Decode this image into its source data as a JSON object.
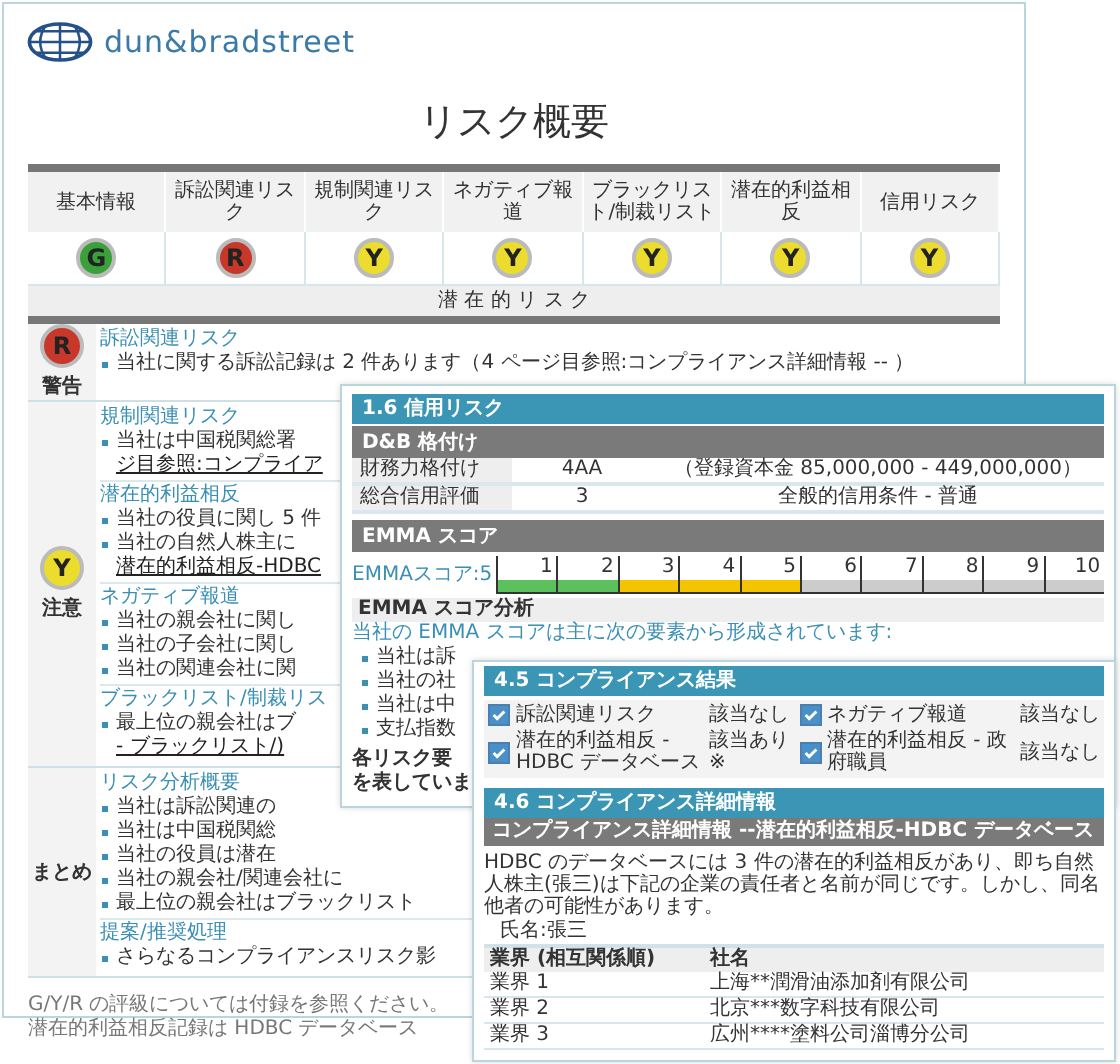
{
  "report": {
    "brand": "dun&bradstreet",
    "title": "リスク概要",
    "summary": [
      {
        "label": "基本情報",
        "rating": "G",
        "color": "#3aa13a"
      },
      {
        "label": "訴訟関連リスク",
        "rating": "R",
        "color": "#c8382a"
      },
      {
        "label": "規制関連リスク",
        "rating": "Y",
        "color": "#ecdc2e"
      },
      {
        "label": "ネガティブ報道",
        "rating": "Y",
        "color": "#ecdc2e"
      },
      {
        "label": "ブラックリスト/制裁リスト",
        "rating": "Y",
        "color": "#ecdc2e"
      },
      {
        "label": "潜在的利益相反",
        "rating": "Y",
        "color": "#ecdc2e"
      },
      {
        "label": "信用リスク",
        "rating": "Y",
        "color": "#ecdc2e"
      }
    ],
    "band": "潜 在 的 リ ス ク",
    "rows": [
      {
        "rating": "R",
        "color": "#c8382a",
        "label": "警告",
        "sections": [
          {
            "heading": "訴訟関連リスク",
            "lines": [
              {
                "kind": "bullet",
                "text": "当社に関する訴訟記録は 2 件あります（4 ページ目参照:コンプライアンス詳細情報 -- ）"
              }
            ]
          }
        ]
      },
      {
        "rating": "Y",
        "color": "#ecdc2e",
        "label": "注意",
        "sections": [
          {
            "heading": "規制関連リスク",
            "lines": [
              {
                "kind": "bullet",
                "text": "当社は中国税関総署"
              },
              {
                "kind": "link",
                "text": "ジ目参照:コンプライア"
              }
            ]
          },
          {
            "heading": "潜在的利益相反",
            "lines": [
              {
                "kind": "bullet",
                "text": "当社の役員に関し 5 件"
              },
              {
                "kind": "bullet",
                "text": "当社の自然人株主に"
              },
              {
                "kind": "link",
                "text": "潜在的利益相反-HDBC"
              }
            ]
          },
          {
            "heading": "ネガティブ報道",
            "lines": [
              {
                "kind": "bullet",
                "text": "当社の親会社に関し"
              },
              {
                "kind": "bullet",
                "text": "当社の子会社に関し"
              },
              {
                "kind": "bullet",
                "text": "当社の関連会社に関"
              }
            ]
          },
          {
            "heading": "ブラックリスト/制裁リス",
            "lines": [
              {
                "kind": "bullet",
                "text": "最上位の親会社はブ"
              },
              {
                "kind": "link",
                "text": "- ブラックリスト/)"
              }
            ]
          }
        ]
      },
      {
        "label": "まとめ",
        "sections": [
          {
            "heading": "リスク分析概要",
            "lines": [
              {
                "kind": "bullet",
                "text": "当社は訴訟関連の"
              },
              {
                "kind": "bullet",
                "text": "当社は中国税関総"
              },
              {
                "kind": "bullet",
                "text": "当社の役員は潜在"
              },
              {
                "kind": "bullet",
                "text": "当社の親会社/関連会社に"
              },
              {
                "kind": "bullet",
                "text": "最上位の親会社はブラックリスト"
              }
            ]
          },
          {
            "heading": "提案/推奨処理",
            "lines": [
              {
                "kind": "bullet",
                "text": "さらなるコンプライアンスリスク影"
              }
            ]
          }
        ]
      }
    ],
    "footnotes": [
      "G/Y/R の評級については付録を参照ください。",
      "潜在的利益相反記録は HDBC データベース"
    ]
  },
  "credit": {
    "title": "1.6 信用リスク",
    "subtitle": "D&B 格付け",
    "ratings": [
      {
        "name": "財務力格付け",
        "value": "4AA",
        "note": "（登録資本金 85,000,000 - 449,000,000）"
      },
      {
        "name": "総合信用評価",
        "value": "3",
        "note": "全般的信用条件 - 普通"
      }
    ],
    "emma_title": "EMMA スコア",
    "emma_label": "EMMAスコア:5",
    "scale": [
      {
        "label": "1",
        "color": "#5cc05c"
      },
      {
        "label": "2",
        "color": "#5cc05c"
      },
      {
        "label": "3",
        "color": "#f5c400"
      },
      {
        "label": "4",
        "color": "#f5c400"
      },
      {
        "label": "5",
        "color": "#f5c400"
      },
      {
        "label": "6",
        "color": "#cccccc"
      },
      {
        "label": "7",
        "color": "#cccccc"
      },
      {
        "label": "8",
        "color": "#cccccc"
      },
      {
        "label": "9",
        "color": "#cccccc"
      },
      {
        "label": "10",
        "color": "#cccccc"
      }
    ],
    "analysis_title": "EMMA スコア分析",
    "analysis_intro": "当社の EMMA スコアは主に次の要素から形成されています:",
    "analysis_bullets": [
      "当社は訴",
      "当社の社",
      "当社は中",
      "支払指数"
    ],
    "analysis_note": [
      "各リスク要",
      "を表していま"
    ]
  },
  "compliance": {
    "title": "4.5 コンプライアンス結果",
    "items": [
      {
        "name": "訴訟関連リスク",
        "checked": true,
        "result": "該当なし"
      },
      {
        "name": "ネガティブ報道",
        "checked": true,
        "result": "該当なし"
      },
      {
        "name": "潜在的利益相反 - HDBC データベース",
        "checked": true,
        "result": "該当あり ※"
      },
      {
        "name": "潜在的利益相反 - 政府職員",
        "checked": true,
        "result": "該当なし"
      }
    ],
    "detail_title": "4.6 コンプライアンス詳細情報",
    "detail_subtitle": "コンプライアンス詳細情報 --潜在的利益相反-HDBC データベース",
    "paragraph": "HDBC のデータベースには 3 件の潜在的利益相反があり、即ち自然人株主(張三)は下記の企業の責任者と名前が同じです。しかし、同名他者の可能性があります。",
    "name_line": "氏名:張三",
    "columns": [
      "業界 (相互関係順)",
      "社名"
    ],
    "rows": [
      [
        "業界 1",
        "上海**潤滑油添加剤有限公司"
      ],
      [
        "業界 2",
        "北京***数字科技有限公司"
      ],
      [
        "業界 3",
        "広州****塗料公司淄博分公司"
      ]
    ]
  }
}
